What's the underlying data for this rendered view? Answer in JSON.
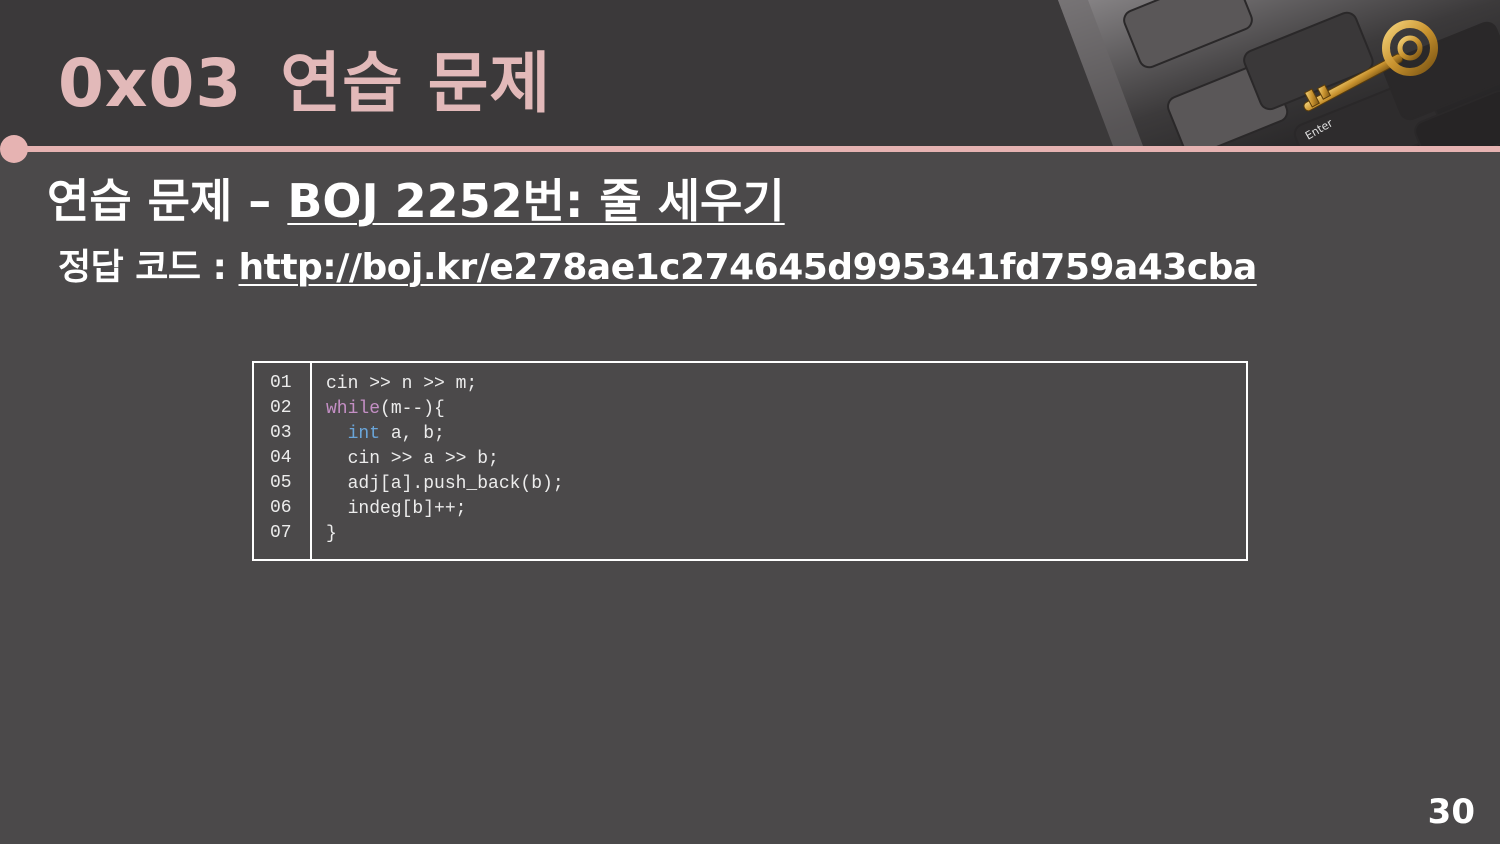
{
  "slide": {
    "title_num": "0x03",
    "title_text": "연습 문제",
    "page_number": "30"
  },
  "problem": {
    "prefix": "연습 문제 – ",
    "link_text": "BOJ 2252번: 줄 세우기",
    "answer_label": "정답 코드 : ",
    "answer_url": "http://boj.kr/e278ae1c274645d995341fd759a43cba"
  },
  "code": {
    "line_numbers": [
      "01",
      "02",
      "03",
      "04",
      "05",
      "06",
      "07"
    ],
    "line1": "cin >> n >> m;",
    "line2_kw": "while",
    "line2_rest": "(m--){",
    "line3_indent": "  ",
    "line3_kw": "int",
    "line3_rest": " a, b;",
    "line4": "  cin >> a >> b;",
    "line5": "  adj[a].push_back(b);",
    "line6": "  indeg[b]++;",
    "line7": "}"
  },
  "colors": {
    "accent_pink": "#e6b3b2",
    "keyword_while": "#c48fc5",
    "keyword_int": "#6aa5d9"
  },
  "icons": {
    "corner_image": "keyboard-key-photo"
  }
}
